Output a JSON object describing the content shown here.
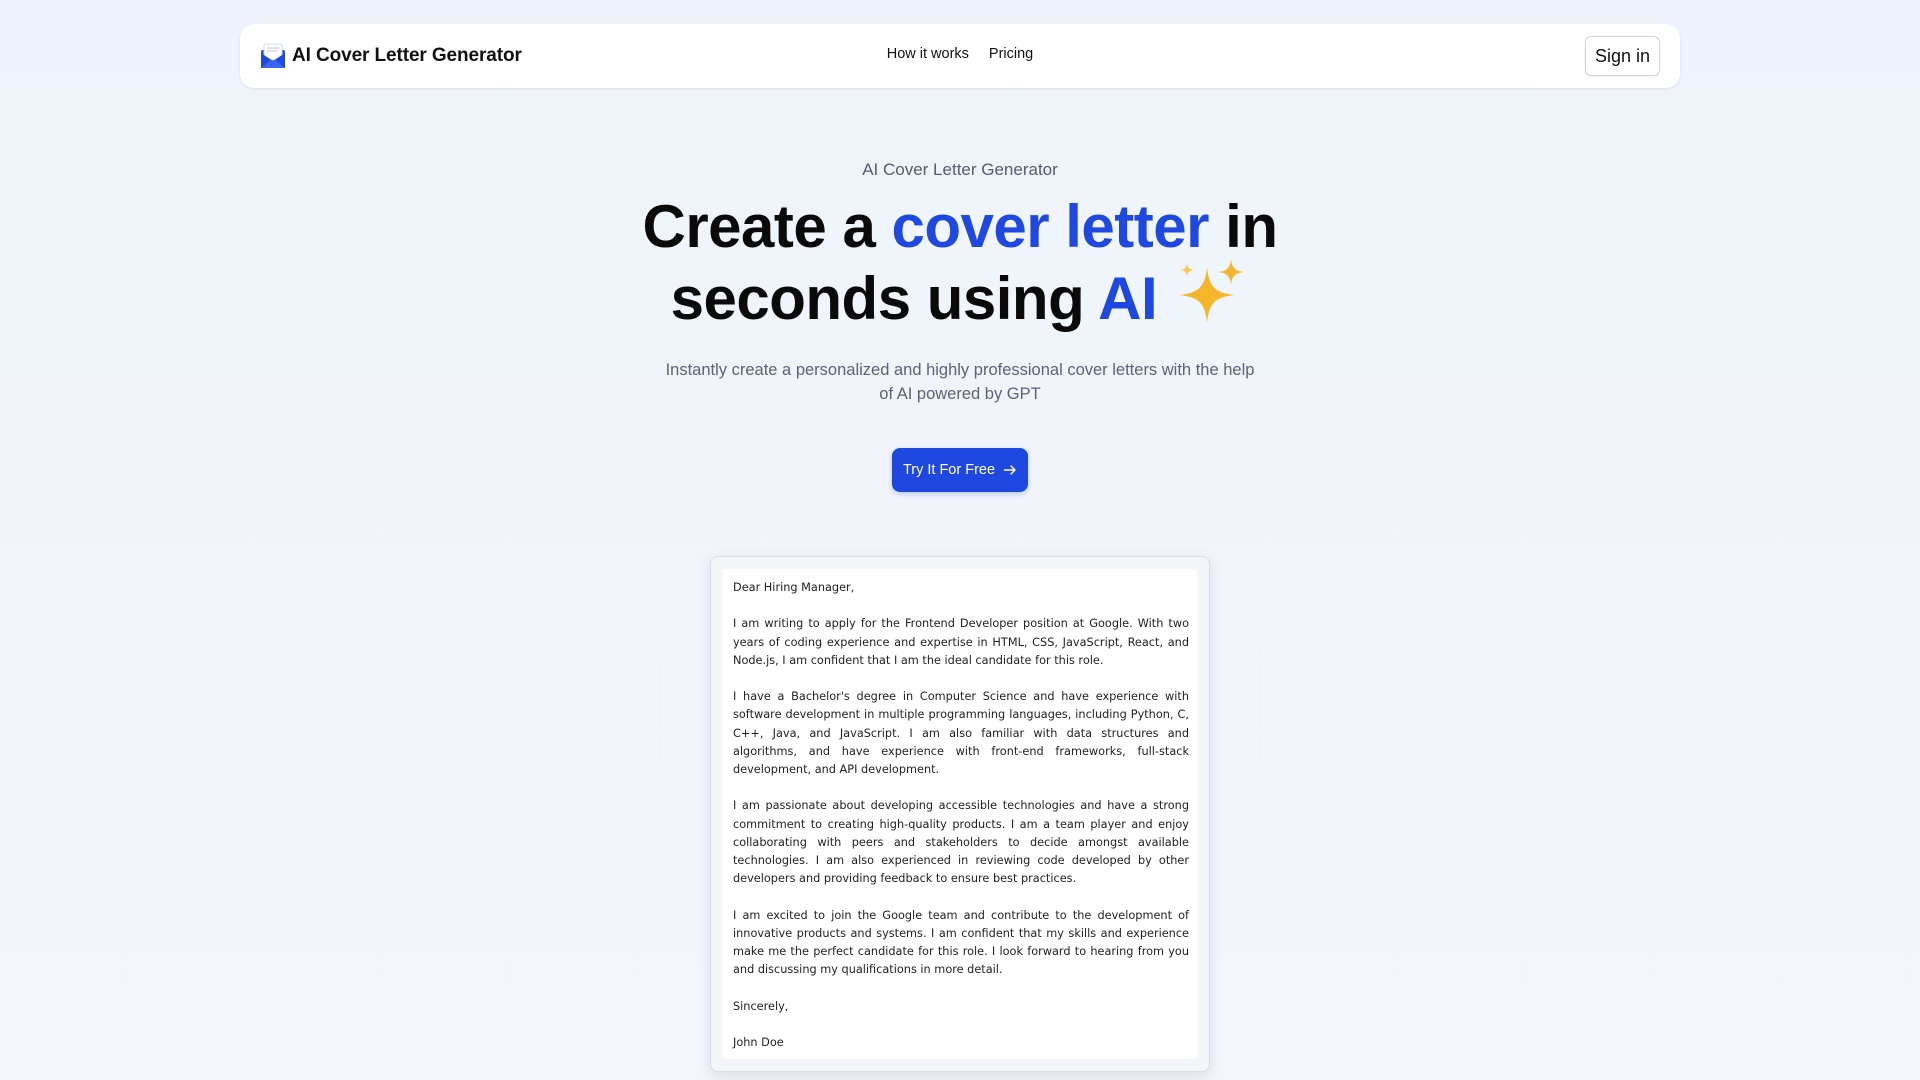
{
  "brand": {
    "name": "AI Cover Letter Generator",
    "logo_icon": "envelope-icon"
  },
  "nav": {
    "links": [
      "How it works",
      "Pricing"
    ],
    "signin_label": "Sign in"
  },
  "hero": {
    "kicker": "AI Cover Letter Generator",
    "title_part1": "Create a ",
    "title_accent1": "cover letter",
    "title_part2": " in seconds using ",
    "title_accent2": "AI",
    "subtitle": "Instantly create a personalized and highly professional cover letters with the help of AI powered by GPT",
    "cta_label": "Try It For Free",
    "accent_color": "#1f48e0"
  },
  "letter": {
    "paragraphs": [
      "Dear Hiring Manager,",
      "I am writing to apply for the Frontend Developer position at Google. With two years of coding experience and expertise in HTML, CSS, JavaScript, React, and Node.js, I am confident that I am the ideal candidate for this role.",
      "I have a Bachelor's degree in Computer Science and have experience with software development in multiple programming languages, including Python, C, C++, Java, and JavaScript. I am also familiar with data structures and algorithms, and have experience with front-end frameworks, full-stack development, and API development.",
      "I am passionate about developing accessible technologies and have a strong commitment to creating high-quality products. I am a team player and enjoy collaborating with peers and stakeholders to decide amongst available technologies. I am also experienced in reviewing code developed by other developers and providing feedback to ensure best practices.",
      "I am excited to join the Google team and contribute to the development of innovative products and systems. I am confident that my skills and experience make me the perfect candidate for this role. I look forward to hearing from you and discussing my qualifications in more detail.",
      "Sincerely,",
      "John Doe"
    ]
  }
}
